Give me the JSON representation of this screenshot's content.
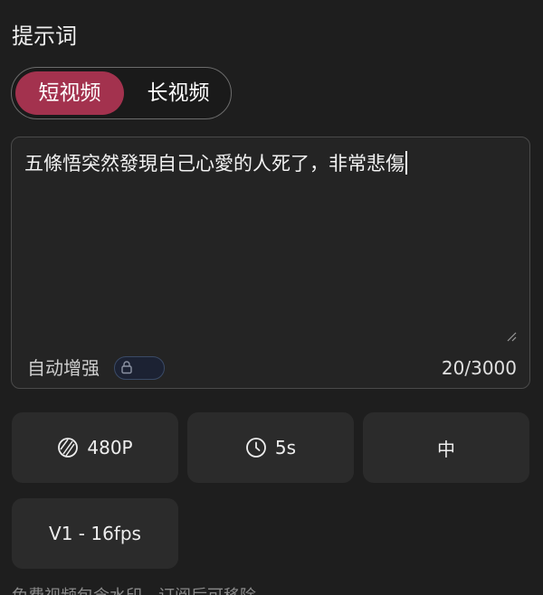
{
  "prompt_section": {
    "title": "提示词"
  },
  "video_type": {
    "options": [
      {
        "label": "短视频",
        "active": true
      },
      {
        "label": "长视频",
        "active": false
      }
    ],
    "active_color": "#a3324e"
  },
  "prompt": {
    "value": "五條悟突然發現自己心愛的人死了，非常悲傷",
    "auto_enhance_label": "自动增强",
    "auto_enhance_locked": true,
    "char_count": "20/3000"
  },
  "settings": {
    "resolution": {
      "label": "480P",
      "icon": "resolution-icon"
    },
    "duration": {
      "label": "5s",
      "icon": "clock-icon"
    },
    "quality": {
      "label": "中"
    },
    "model": {
      "label": "V1 - 16fps"
    }
  },
  "footnote": "免费视频包含水印，订阅后可移除"
}
